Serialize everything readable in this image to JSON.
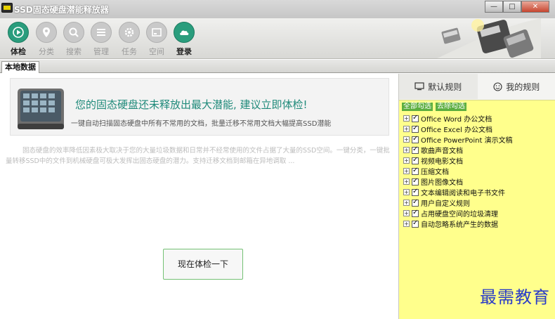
{
  "window": {
    "title": "SSD固态硬盘潜能释放器",
    "minimize": "—",
    "maximize": "□",
    "close": "✕"
  },
  "toolbar": [
    {
      "label": "体检",
      "icon": "play-icon",
      "active": true
    },
    {
      "label": "分类",
      "icon": "pin-icon"
    },
    {
      "label": "搜索",
      "icon": "search-icon"
    },
    {
      "label": "管理",
      "icon": "list-icon"
    },
    {
      "label": "任务",
      "icon": "gear-icon"
    },
    {
      "label": "空间",
      "icon": "drive-icon"
    },
    {
      "label": "登录",
      "icon": "cloud-icon"
    }
  ],
  "tab": {
    "label": "本地数据"
  },
  "main": {
    "headline": "您的固态硬盘还未释放出最大潜能, 建议立即体检!",
    "subline": "一键自动扫描固态硬盘中所有不常用的文档，批量迁移不常用文档大幅提高SSD潜能",
    "description": "固态硬盘的效率降低因素极大取决于您的大量垃圾数据和日常并不经常使用的文件占据了大量的SSD空间。一键分类，一键批量转移SSD中的文件到机械硬盘可极大发挥出固态硬盘的潜力。支持迁移文档到邮箱在异地调取 ...",
    "check_button": "现在体检一下"
  },
  "rules": {
    "tab_default": "默认规则",
    "tab_mine": "我的规则",
    "select_all": "全部勾选",
    "deselect_all": "去除勾选",
    "items": [
      "Office Word 办公文档",
      "Office Excel 办公文档",
      "Office PowerPoint 演示文稿",
      "歌曲声音文档",
      "视频电影文档",
      "压缩文档",
      "图片图像文档",
      "文本编辑阅读和电子书文件",
      "用户自定义规则",
      "占用硬盘空间的垃圾清理",
      "自动忽略系统产生的数据"
    ]
  },
  "watermark": "最需教育",
  "colors": {
    "accent": "#2a9d7d",
    "panel": "#ffff8c",
    "headline": "#1f8a7a"
  }
}
